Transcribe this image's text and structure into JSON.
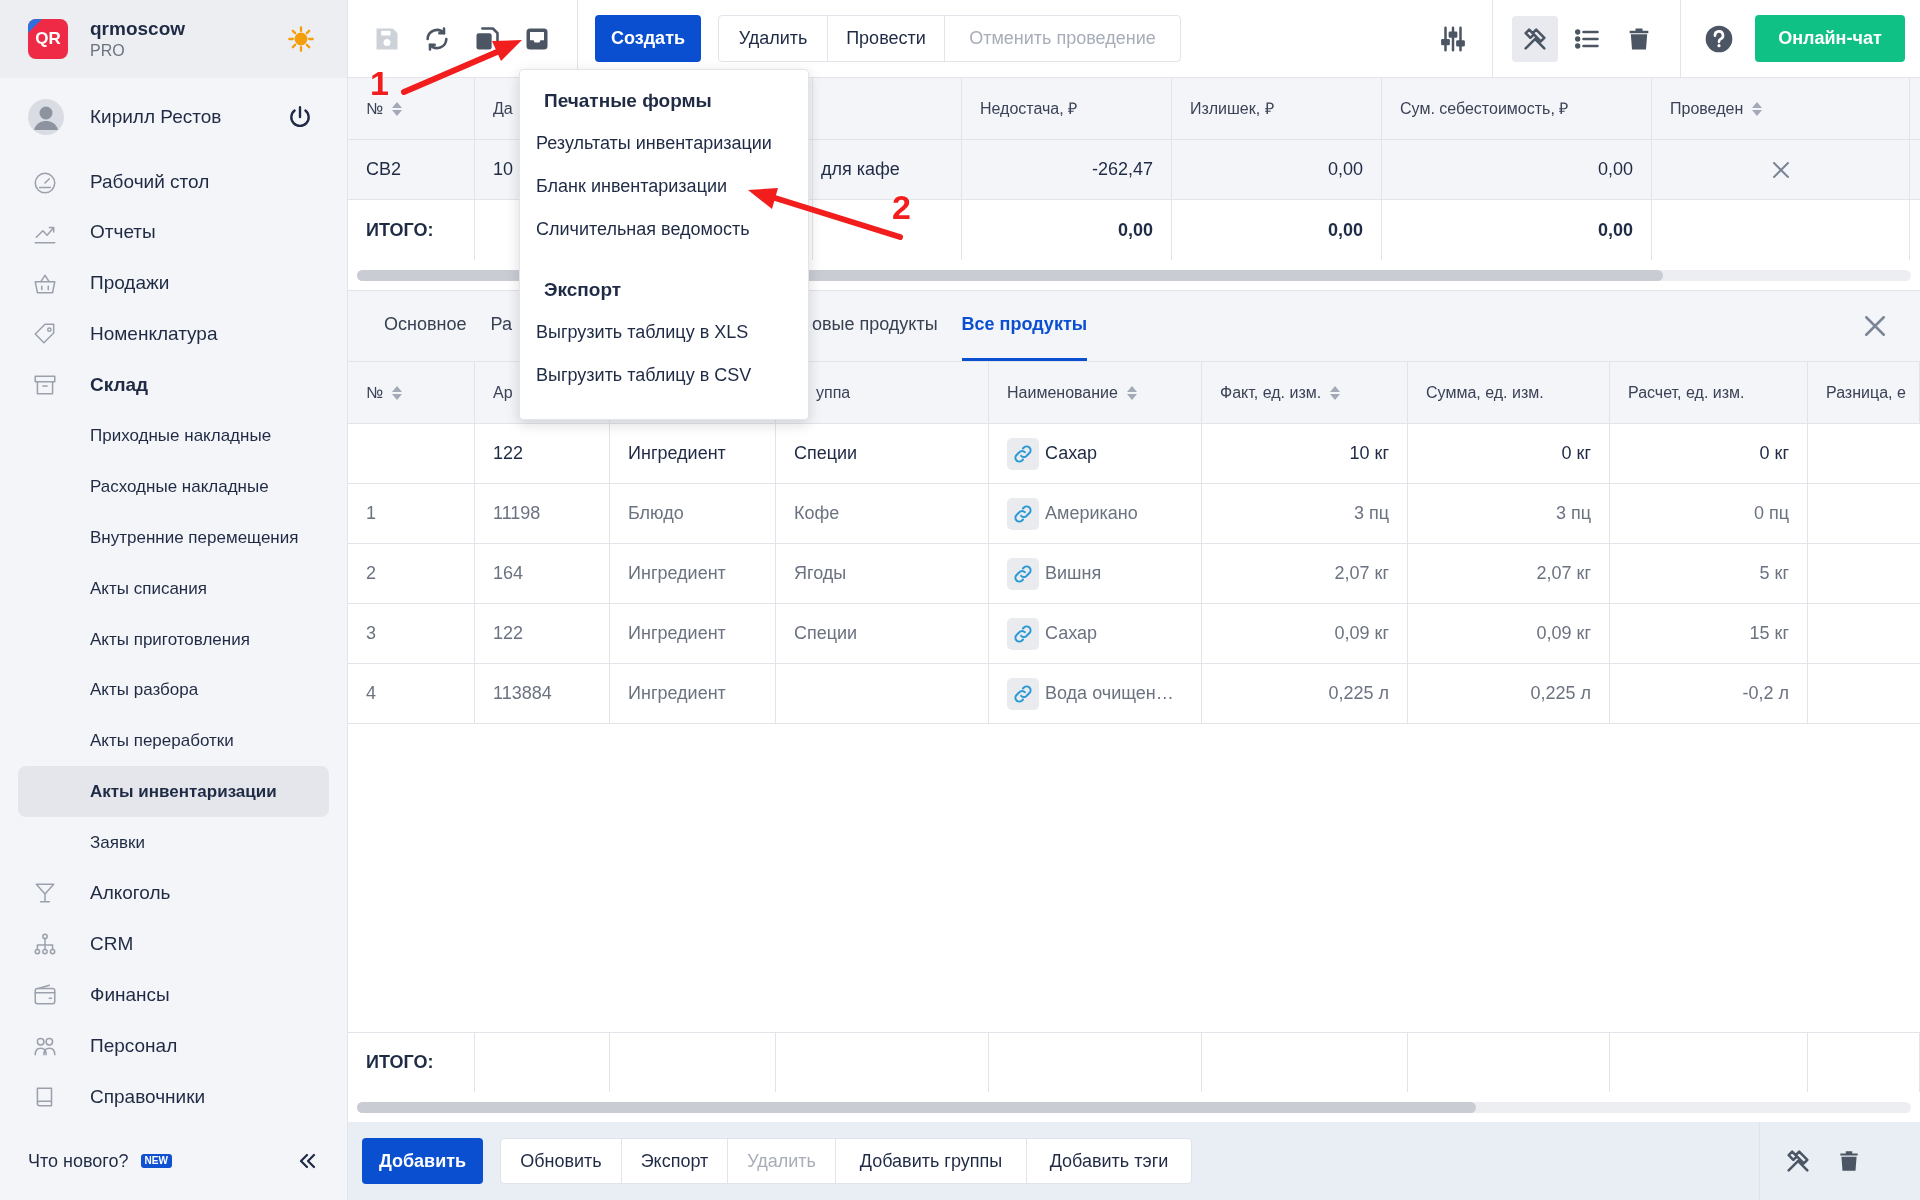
{
  "sidebar": {
    "brand": {
      "logo": "QR",
      "name": "qrmoscow",
      "plan": "PRO"
    },
    "user": {
      "name": "Кирилл Рестов"
    },
    "items": [
      {
        "label": "Рабочий стол",
        "selected": false,
        "expanded": false
      },
      {
        "label": "Отчеты",
        "selected": false,
        "expanded": false
      },
      {
        "label": "Продажи",
        "selected": false,
        "expanded": false
      },
      {
        "label": "Номенклатура",
        "selected": false,
        "expanded": false
      },
      {
        "label": "Склад",
        "selected": false,
        "expanded": true,
        "children": [
          {
            "label": "Приходные накладные",
            "selected": false
          },
          {
            "label": "Расходные накладные",
            "selected": false
          },
          {
            "label": "Внутренние перемещения",
            "selected": false
          },
          {
            "label": "Акты списания",
            "selected": false
          },
          {
            "label": "Акты приготовления",
            "selected": false
          },
          {
            "label": "Акты разбора",
            "selected": false
          },
          {
            "label": "Акты переработки",
            "selected": false
          },
          {
            "label": "Акты инвентаризации",
            "selected": true
          },
          {
            "label": "Заявки",
            "selected": false
          }
        ]
      },
      {
        "label": "Алкоголь",
        "selected": false,
        "expanded": false
      },
      {
        "label": "CRM",
        "selected": false,
        "expanded": false
      },
      {
        "label": "Финансы",
        "selected": false,
        "expanded": false
      },
      {
        "label": "Персонал",
        "selected": false,
        "expanded": false
      },
      {
        "label": "Справочники",
        "selected": false,
        "expanded": false
      }
    ],
    "footer": {
      "label": "Что нового?",
      "badge": "NEW"
    }
  },
  "toolbar": {
    "left_icons": [
      {
        "kind": "save",
        "disabled": true
      },
      {
        "kind": "refresh",
        "disabled": false
      },
      {
        "kind": "copy",
        "disabled": false
      },
      {
        "kind": "print",
        "disabled": false
      }
    ],
    "create": "Создать",
    "actions": [
      {
        "label": "Удалить",
        "disabled": false
      },
      {
        "label": "Провести",
        "disabled": false
      },
      {
        "label": "Отменить проведение",
        "disabled": true
      }
    ],
    "right_icons": [
      {
        "kind": "tools",
        "active": true
      },
      {
        "kind": "list",
        "active": false
      },
      {
        "kind": "trash",
        "active": false
      }
    ],
    "chat": "Онлайн-чат"
  },
  "upper_table": {
    "columns": [
      "№",
      "Да",
      "",
      "Недостача, ₽",
      "Излишек, ₽",
      "Сум. себестоимость, ₽",
      "Проведен"
    ],
    "rows": [
      {
        "cells": [
          "СВ2",
          "10",
          "для кафе",
          "-262,47",
          "0,00",
          "0,00"
        ],
        "posted": false
      }
    ],
    "totals": {
      "label": "ИТОГО:",
      "values": [
        "0,00",
        "0,00",
        "0,00"
      ]
    }
  },
  "dropdown": {
    "sections": [
      {
        "title": "Печатные формы",
        "items": [
          "Результаты инвентаризации",
          "Бланк инвентаризации",
          "Сличительная ведомость"
        ]
      },
      {
        "title": "Экспорт",
        "items": [
          "Выгрузить таблицу в XLS",
          "Выгрузить таблицу в CSV"
        ]
      }
    ]
  },
  "annotations": [
    {
      "label": "1"
    },
    {
      "label": "2"
    }
  ],
  "tabs": [
    {
      "label": "Основное",
      "selected": false
    },
    {
      "label": "Ра",
      "selected": false
    },
    {
      "label": "овые продукты",
      "selected": false
    },
    {
      "label": "Все продукты",
      "selected": true
    }
  ],
  "lower_table": {
    "columns": [
      "№",
      "Ар",
      "",
      "уппа",
      "Наименование",
      "Факт, ед. изм.",
      "Сумма, ед. изм.",
      "Расчет, ед. изм.",
      "Разница, е"
    ],
    "rows": [
      {
        "cells": [
          null,
          "122",
          "Ингредиент",
          "Специи",
          "Сахар",
          "10 кг",
          "0 кг",
          "0 кг"
        ],
        "muted": false
      },
      {
        "cells": [
          "1",
          "11198",
          "Блюдо",
          "Кофе",
          "Американо",
          "3 пц",
          "3 пц",
          "0 пц"
        ],
        "muted": true
      },
      {
        "cells": [
          "2",
          "164",
          "Ингредиент",
          "Ягоды",
          "Вишня",
          "2,07 кг",
          "2,07 кг",
          "5 кг"
        ],
        "muted": true
      },
      {
        "cells": [
          "3",
          "122",
          "Ингредиент",
          "Специи",
          "Сахар",
          "0,09 кг",
          "0,09 кг",
          "15 кг"
        ],
        "muted": true
      },
      {
        "cells": [
          "4",
          "113884",
          "Ингредиент",
          null,
          "Вода очищен…",
          "0,225 л",
          "0,225 л",
          "-0,2 л"
        ],
        "muted": true
      }
    ],
    "totals": "ИТОГО:"
  },
  "bottom_bar": {
    "add": "Добавить",
    "actions": [
      {
        "label": "Обновить",
        "disabled": false
      },
      {
        "label": "Экспорт",
        "disabled": false
      },
      {
        "label": "Удалить",
        "disabled": true
      },
      {
        "label": "Добавить группы",
        "disabled": false
      },
      {
        "label": "Добавить тэги",
        "disabled": false
      }
    ]
  }
}
